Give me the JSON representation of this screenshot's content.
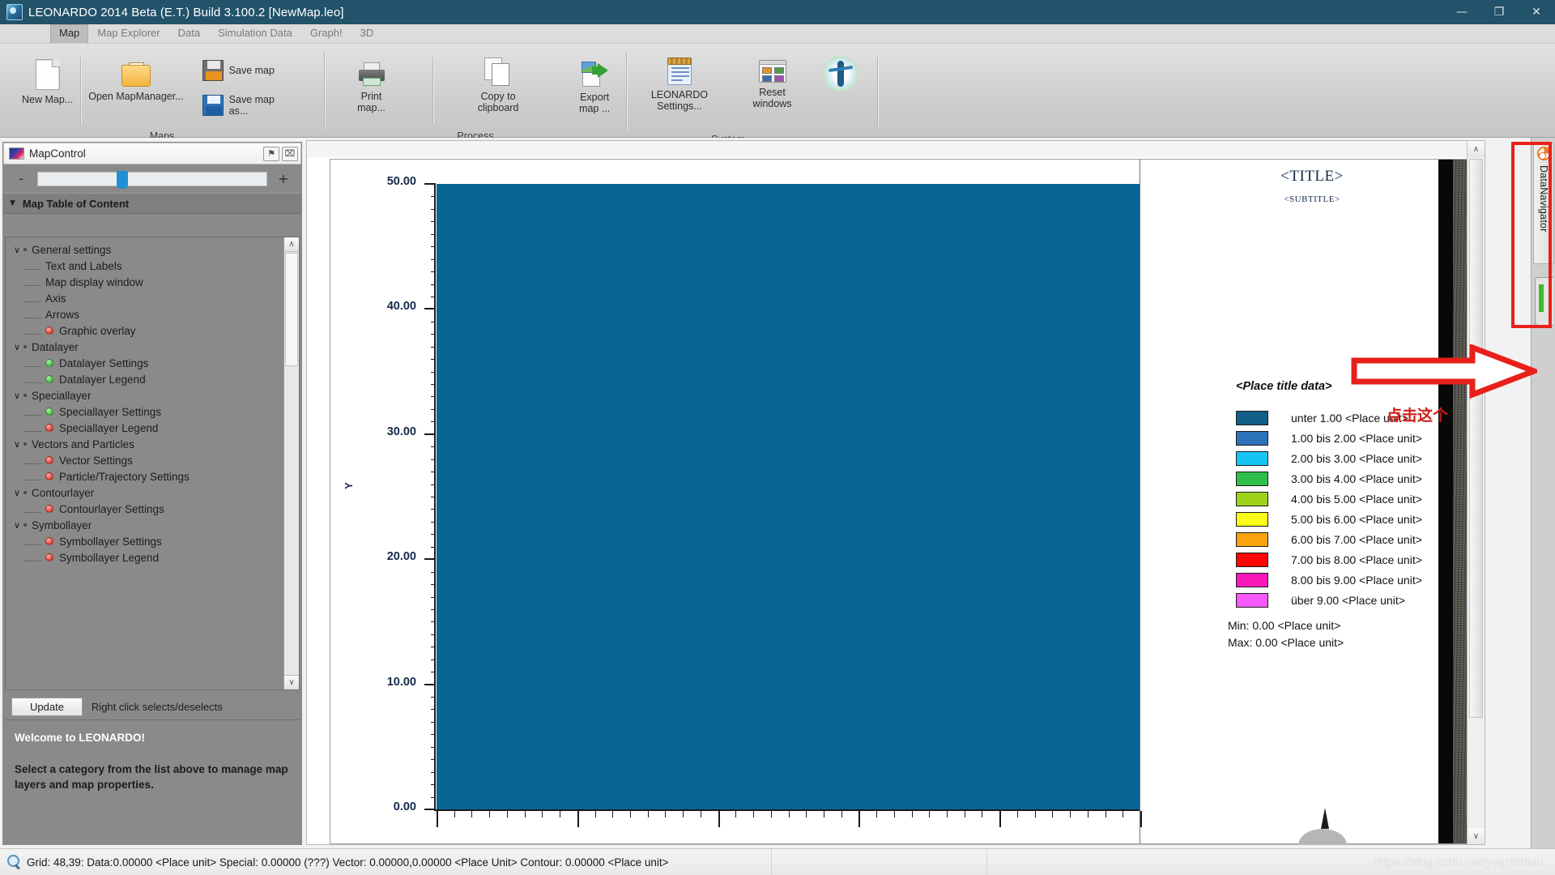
{
  "window": {
    "title": "LEONARDO 2014 Beta (E.T.) Build 3.100.2 [NewMap.leo]",
    "minimize_label": "—",
    "maximize_label": "❐",
    "close_label": "✕"
  },
  "ribbon": {
    "tabs": [
      {
        "label": "Map",
        "active": true
      },
      {
        "label": "Map Explorer",
        "active": false
      },
      {
        "label": "Data",
        "active": false
      },
      {
        "label": "Simulation Data",
        "active": false
      },
      {
        "label": "Graph!",
        "active": false
      },
      {
        "label": "3D",
        "active": false
      }
    ],
    "groups": [
      {
        "title": "Maps",
        "buttons": [
          {
            "label": "New Map...",
            "icon": "new-document-icon"
          },
          {
            "label": "Open MapManager...",
            "icon": "open-folder-icon"
          },
          {
            "label": "Save map",
            "icon": "save-floppy-icon"
          },
          {
            "label": "Save map as...",
            "icon": "save-as-floppy-icon"
          }
        ]
      },
      {
        "title": "Process",
        "buttons": [
          {
            "label": "Print map...",
            "icon": "printer-icon"
          },
          {
            "label": "Copy to clipboard",
            "icon": "copy-pages-icon"
          },
          {
            "label": "Export map ...",
            "icon": "export-image-icon"
          }
        ]
      },
      {
        "title": "System",
        "buttons": [
          {
            "label": "LEONARDO Settings...",
            "icon": "notepad-settings-icon"
          },
          {
            "label": "Reset windows",
            "icon": "reset-windows-icon"
          },
          {
            "label": "",
            "icon": "vitruvian-man-icon"
          }
        ]
      }
    ]
  },
  "mapcontrol": {
    "panel_title": "MapControl",
    "pin_glyph": "⚑",
    "close_glyph": "⌧",
    "zoom_minus": "-",
    "zoom_plus": "+",
    "toc_header": "Map Table of Content",
    "toc_caret": "▼",
    "tree": [
      {
        "label": "General settings",
        "level": 0,
        "chev": "∨",
        "dot": null
      },
      {
        "label": "Text and Labels",
        "level": 1,
        "chev": "",
        "dot": null
      },
      {
        "label": "Map display window",
        "level": 1,
        "chev": "",
        "dot": null
      },
      {
        "label": "Axis",
        "level": 1,
        "chev": "",
        "dot": null
      },
      {
        "label": "Arrows",
        "level": 1,
        "chev": "",
        "dot": null
      },
      {
        "label": "Graphic overlay",
        "level": 1,
        "chev": "",
        "dot": "red"
      },
      {
        "label": "Datalayer",
        "level": 0,
        "chev": "∨",
        "dot": null
      },
      {
        "label": "Datalayer Settings",
        "level": 1,
        "chev": "",
        "dot": "green"
      },
      {
        "label": "Datalayer Legend",
        "level": 1,
        "chev": "",
        "dot": "green"
      },
      {
        "label": "Speciallayer",
        "level": 0,
        "chev": "∨",
        "dot": null
      },
      {
        "label": "Speciallayer Settings",
        "level": 1,
        "chev": "",
        "dot": "green"
      },
      {
        "label": "Speciallayer Legend",
        "level": 1,
        "chev": "",
        "dot": "red"
      },
      {
        "label": "Vectors and Particles",
        "level": 0,
        "chev": "∨",
        "dot": null
      },
      {
        "label": "Vector Settings",
        "level": 1,
        "chev": "",
        "dot": "red"
      },
      {
        "label": "Particle/Trajectory Settings",
        "level": 1,
        "chev": "",
        "dot": "red"
      },
      {
        "label": "Contourlayer",
        "level": 0,
        "chev": "∨",
        "dot": null
      },
      {
        "label": "Contourlayer Settings",
        "level": 1,
        "chev": "",
        "dot": "red"
      },
      {
        "label": "Symbollayer",
        "level": 0,
        "chev": "∨",
        "dot": null
      },
      {
        "label": "Symbollayer Settings",
        "level": 1,
        "chev": "",
        "dot": "red"
      },
      {
        "label": "Symbollayer Legend",
        "level": 1,
        "chev": "",
        "dot": "red"
      }
    ],
    "scroll_up_glyph": "∧",
    "scroll_down_glyph": "∨",
    "update_button": "Update",
    "update_hint": "Right click selects/deselects",
    "welcome_heading": "Welcome to LEONARDO!",
    "welcome_body": "Select a category from the list above to manage map layers and map properties."
  },
  "map": {
    "title": "<TITLE>",
    "subtitle": "<SUBTITLE>",
    "legend_title": "<Place title data>",
    "legend_entries": [
      {
        "label": "unter 1.00 <Place unit>",
        "color": "#115f86"
      },
      {
        "label": "1.00 bis 2.00 <Place unit>",
        "color": "#2d73ba"
      },
      {
        "label": "2.00 bis 3.00 <Place unit>",
        "color": "#15c6f5"
      },
      {
        "label": "3.00 bis 4.00 <Place unit>",
        "color": "#2fbe4a"
      },
      {
        "label": "4.00 bis 5.00 <Place unit>",
        "color": "#9ed21b"
      },
      {
        "label": "5.00 bis 6.00 <Place unit>",
        "color": "#fdfd17"
      },
      {
        "label": "6.00 bis 7.00 <Place unit>",
        "color": "#f9a310"
      },
      {
        "label": "7.00 bis 8.00 <Place unit>",
        "color": "#fd0706"
      },
      {
        "label": "8.00 bis 9.00 <Place unit>",
        "color": "#fb18bb"
      },
      {
        "label": "über 9.00 <Place unit>",
        "color": "#f759fb"
      }
    ],
    "min_text": "Min: 0.00 <Place unit>",
    "max_text": "Max: 0.00 <Place unit>",
    "data_fill_color": "#0a6496",
    "scroll_up_glyph": "∧",
    "scroll_down_glyph": "∨"
  },
  "chart_data": {
    "type": "heatmap",
    "title": "<TITLE>",
    "subtitle": "<SUBTITLE>",
    "xlabel": "",
    "ylabel": "Y",
    "ylim": [
      0,
      50
    ],
    "yticks": [
      0.0,
      10.0,
      20.0,
      30.0,
      40.0,
      50.0
    ],
    "ytick_labels": [
      "0.00",
      "10.00",
      "20.00",
      "30.00",
      "40.00",
      "50.00"
    ],
    "grid": false,
    "legend_position": "right",
    "legend_title": "<Place title data>",
    "legend_entries": [
      {
        "label": "unter 1.00 <Place unit>",
        "color": "#115f86",
        "range": [
          null,
          1.0
        ]
      },
      {
        "label": "1.00 bis 2.00 <Place unit>",
        "color": "#2d73ba",
        "range": [
          1.0,
          2.0
        ]
      },
      {
        "label": "2.00 bis 3.00 <Place unit>",
        "color": "#15c6f5",
        "range": [
          2.0,
          3.0
        ]
      },
      {
        "label": "3.00 bis 4.00 <Place unit>",
        "color": "#2fbe4a",
        "range": [
          3.0,
          4.0
        ]
      },
      {
        "label": "4.00 bis 5.00 <Place unit>",
        "color": "#9ed21b",
        "range": [
          4.0,
          5.0
        ]
      },
      {
        "label": "5.00 bis 6.00 <Place unit>",
        "color": "#fdfd17",
        "range": [
          5.0,
          6.0
        ]
      },
      {
        "label": "6.00 bis 7.00 <Place unit>",
        "color": "#f9a310",
        "range": [
          6.0,
          7.0
        ]
      },
      {
        "label": "7.00 bis 8.00 <Place unit>",
        "color": "#fd0706",
        "range": [
          7.0,
          8.0
        ]
      },
      {
        "label": "8.00 bis 9.00 <Place unit>",
        "color": "#fb18bb",
        "range": [
          8.0,
          9.0
        ]
      },
      {
        "label": "über 9.00 <Place unit>",
        "color": "#f759fb",
        "range": [
          9.0,
          null
        ]
      }
    ],
    "data_min": 0.0,
    "data_max": 0.0,
    "uniform_value": 0.0,
    "uniform_fill_color": "#0a6496",
    "annotations": [
      "Min: 0.00 <Place unit>",
      "Max: 0.00 <Place unit>"
    ]
  },
  "navigator": {
    "tab_label": "DataNavigator",
    "tab_icon": "lifebuoy-icon"
  },
  "annotation": {
    "callout_text": "点击这个",
    "arrow_color": "#e8201a",
    "highlight_color": "#e8201a"
  },
  "statusbar": {
    "icon": "magnifier-icon",
    "text": "Grid: 48,39: Data:0.00000 <Place unit> Special: 0.00000 (???) Vector: 0.00000,0.00000 <Place Unit> Contour: 0.00000 <Place unit>"
  },
  "watermark": {
    "text": "https://blog.csdn.net/ysqzhatian"
  }
}
